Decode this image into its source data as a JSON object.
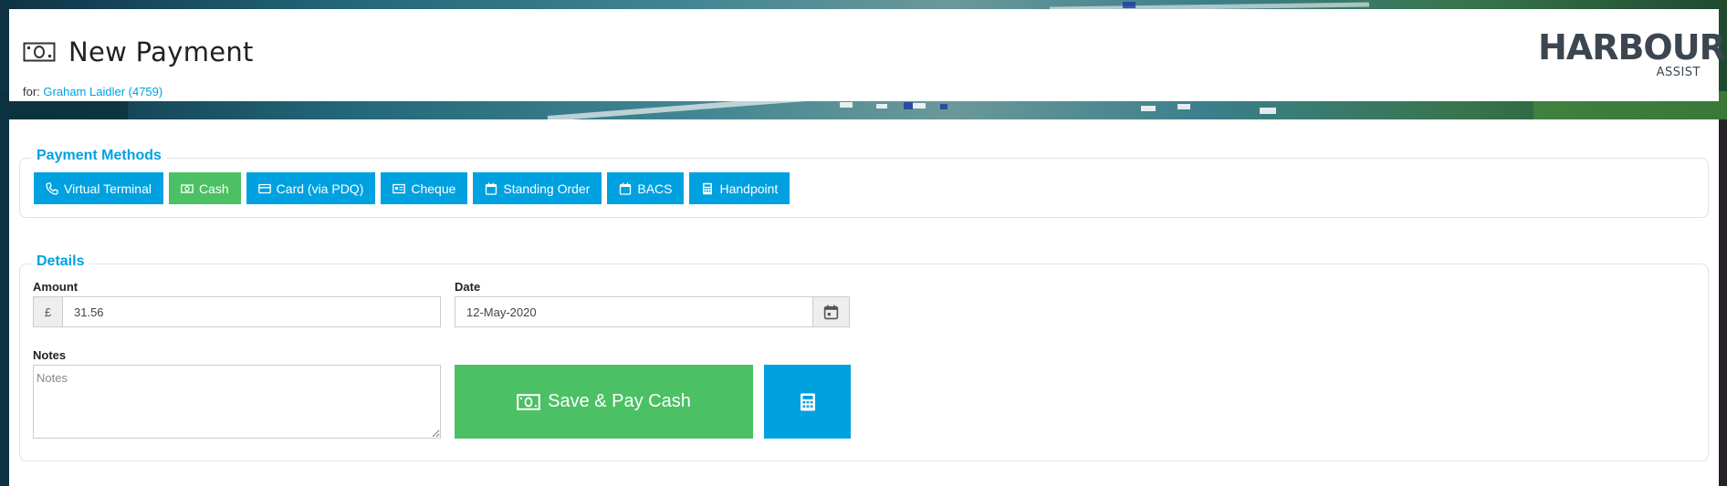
{
  "header": {
    "title": "New Payment",
    "for_prefix": "for:",
    "customer_link": "Graham Laidler (4759)",
    "logo_main": "HARBOUR",
    "logo_sub": "ASSIST"
  },
  "payment_methods": {
    "legend": "Payment Methods",
    "buttons": [
      {
        "label": "Virtual Terminal",
        "icon": "phone-icon",
        "active": false
      },
      {
        "label": "Cash",
        "icon": "money-icon",
        "active": true
      },
      {
        "label": "Card (via PDQ)",
        "icon": "credit-card-icon",
        "active": false
      },
      {
        "label": "Cheque",
        "icon": "cheque-icon",
        "active": false
      },
      {
        "label": "Standing Order",
        "icon": "calendar-icon",
        "active": false
      },
      {
        "label": "BACS",
        "icon": "calendar-icon",
        "active": false
      },
      {
        "label": "Handpoint",
        "icon": "calculator-icon",
        "active": false
      }
    ]
  },
  "details": {
    "legend": "Details",
    "amount_label": "Amount",
    "currency_symbol": "£",
    "amount_value": "31.56",
    "date_label": "Date",
    "date_value": "12-May-2020",
    "notes_label": "Notes",
    "notes_placeholder": "Notes",
    "notes_value": "",
    "save_button_label": "Save & Pay Cash"
  },
  "colors": {
    "primary": "#00a1e0",
    "success": "#4cc064",
    "logo": "#3c4650"
  }
}
